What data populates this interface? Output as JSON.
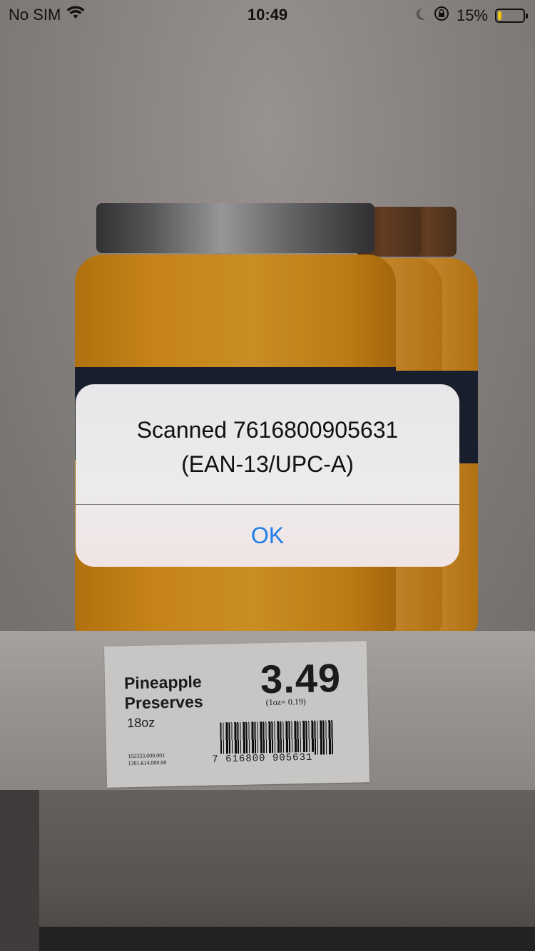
{
  "status_bar": {
    "carrier": "No SIM",
    "time": "10:49",
    "battery_percent": "15%",
    "battery_level": 0.15,
    "icons": [
      "wifi-icon",
      "moon-icon",
      "orientation-lock-icon",
      "battery-icon"
    ]
  },
  "alert": {
    "message": "Scanned 7616800905631\n(EAN-13/UPC-A)",
    "ok_label": "OK",
    "accent_color": "#1f7ee8"
  },
  "camera_scene": {
    "price_label": {
      "product_name": "Pineapple Preserves",
      "size": "18oz",
      "price": "3.49",
      "unit_price": "(1oz= 0.19)",
      "codes": [
        "102333.000.001",
        "1301.614.000.00"
      ],
      "barcode_digits": "7 616800 905631"
    }
  }
}
